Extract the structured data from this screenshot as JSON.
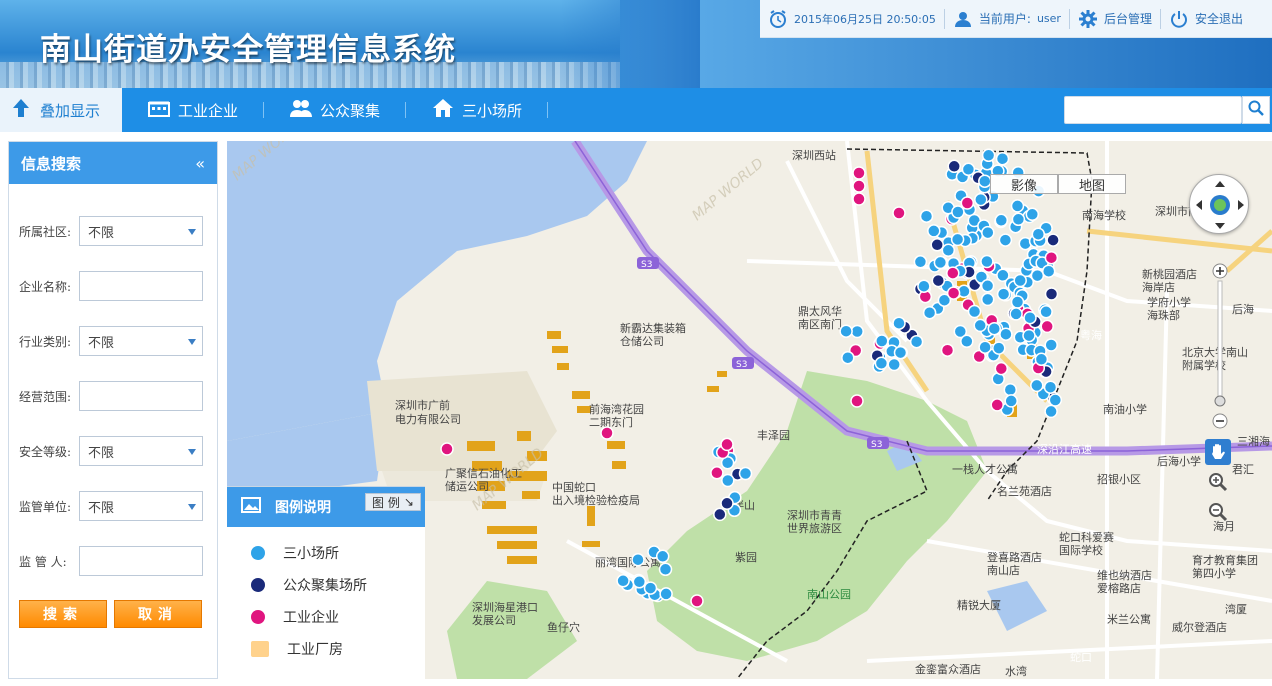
{
  "header": {
    "title": "南山街道办安全管理信息系统",
    "datetime": "2015年06月25日 20:50:05",
    "current_user_label": "当前用户:",
    "current_user": "user",
    "admin_label": "后台管理",
    "logout_label": "安全退出"
  },
  "nav": {
    "tabs": [
      {
        "label": "叠加显示",
        "icon": "upload-arrow-icon",
        "active": true
      },
      {
        "label": "工业企业",
        "icon": "factory-icon",
        "active": false
      },
      {
        "label": "公众聚集",
        "icon": "people-icon",
        "active": false
      },
      {
        "label": "三小场所",
        "icon": "house-icon",
        "active": false
      }
    ],
    "search_placeholder": ""
  },
  "sidebar": {
    "title": "信息搜索",
    "collapse_icon": "double-chevron-left-icon",
    "fields": [
      {
        "label": "所属社区:",
        "type": "select",
        "value": "不限"
      },
      {
        "label": "企业名称:",
        "type": "input",
        "value": ""
      },
      {
        "label": "行业类别:",
        "type": "select",
        "value": "不限"
      },
      {
        "label": "经营范围:",
        "type": "input",
        "value": ""
      },
      {
        "label": "安全等级:",
        "type": "select",
        "value": "不限"
      },
      {
        "label": "监管单位:",
        "type": "select",
        "value": "不限"
      },
      {
        "label": "监 管 人:",
        "type": "input",
        "value": ""
      }
    ],
    "search_button": "搜索",
    "cancel_button": "取消"
  },
  "map": {
    "toggle": [
      "影像",
      "地图"
    ],
    "active_toggle": "地图",
    "labels": [
      "深圳西站",
      "深圳市广前电力有限公司",
      "新霸达集装箱仓储公司",
      "前海湾花园二期东门",
      "中国蛇口出入境检验检疫局",
      "广聚信石油化工储运公司",
      "深圳市青青世界旅游区",
      "南山公园",
      "丽湾国际公寓",
      "深圳海星港口发展公司",
      "鱼仔穴",
      "云伴山",
      "丰泽园",
      "紫园",
      "鼎太风华南区南门",
      "一栈人才公寓",
      "名兰苑酒店",
      "招银小区",
      "蛇口科爱赛国际学校",
      "登喜路酒店南山店",
      "精锐大厦",
      "金銮富众酒店",
      "水湾",
      "蛇口",
      "湾厦",
      "海月",
      "后海",
      "南油小学",
      "深圳市南海中学",
      "学府小学海珠部",
      "新桃园酒店海岸店",
      "北京大学南山附属学校",
      "育才教育集团第四小学",
      "威尔登酒店",
      "米兰公寓",
      "维也纳酒店爱榕路店",
      "后海小学",
      "君汇",
      "三湘海",
      "海岸城",
      "东海南海学校",
      "S3",
      "深沿江高速",
      "粤海"
    ],
    "watermark": "MAP WORLD",
    "accent_colors": {
      "sanxiao": "#2ea3e8",
      "gongzhong": "#1a2a7a",
      "gongye": "#e0157f",
      "changfang": "#ffd28c"
    }
  },
  "legend": {
    "title": "图例说明",
    "toggle_label": "图 例",
    "items": [
      {
        "label": "三小场所",
        "color": "#2ea3e8",
        "shape": "dot"
      },
      {
        "label": "公众聚集场所",
        "color": "#1a2a7a",
        "shape": "dot"
      },
      {
        "label": "工业企业",
        "color": "#e0157f",
        "shape": "dot"
      },
      {
        "label": "工业厂房",
        "color": "#ffd28c",
        "shape": "rect"
      }
    ]
  }
}
